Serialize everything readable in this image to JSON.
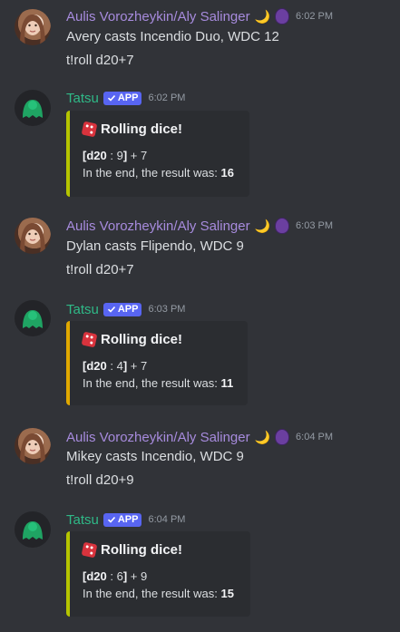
{
  "messages": [
    {
      "author": "Aulis Vorozheykin/Aly Salinger",
      "decor_moon": "🌙",
      "time": "6:02 PM",
      "lines": [
        "Avery casts Incendio Duo, WDC 12",
        "t!roll d20+7"
      ]
    },
    {
      "author": "Tatsu",
      "app_tag": "APP",
      "time": "6:02 PM",
      "embed": {
        "title": "Rolling dice!",
        "roll_die": "d20",
        "roll_value": "9",
        "roll_mod": "+ 7",
        "result_prefix": "In the end, the result was:",
        "result": "16",
        "accent": "#b5c500"
      }
    },
    {
      "author": "Aulis Vorozheykin/Aly Salinger",
      "decor_moon": "🌙",
      "time": "6:03 PM",
      "lines": [
        "Dylan casts Flipendo, WDC 9",
        "t!roll d20+7"
      ]
    },
    {
      "author": "Tatsu",
      "app_tag": "APP",
      "time": "6:03 PM",
      "embed": {
        "title": "Rolling dice!",
        "roll_die": "d20",
        "roll_value": "4",
        "roll_mod": "+ 7",
        "result_prefix": "In the end, the result was:",
        "result": "11",
        "accent": "#e0a800"
      }
    },
    {
      "author": "Aulis Vorozheykin/Aly Salinger",
      "decor_moon": "🌙",
      "time": "6:04 PM",
      "lines": [
        "Mikey casts Incendio, WDC 9",
        "t!roll d20+9"
      ]
    },
    {
      "author": "Tatsu",
      "app_tag": "APP",
      "time": "6:04 PM",
      "embed": {
        "title": "Rolling dice!",
        "roll_die": "d20",
        "roll_value": "6",
        "roll_mod": "+ 9",
        "result_prefix": "In the end, the result was:",
        "result": "15",
        "accent": "#b5c500"
      }
    }
  ]
}
